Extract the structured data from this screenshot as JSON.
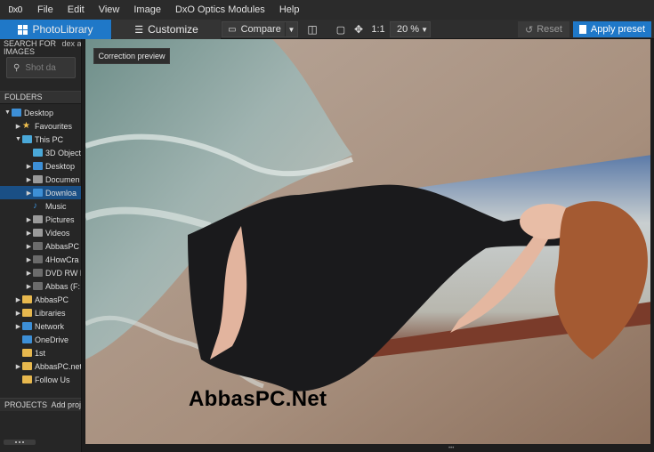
{
  "app": {
    "logo": "DxO"
  },
  "menu": [
    "File",
    "Edit",
    "View",
    "Image",
    "DxO Optics Modules",
    "Help"
  ],
  "toolbar": {
    "tab_photolibrary": "PhotoLibrary",
    "tab_customize": "Customize",
    "compare_label": "Compare",
    "one_to_one": "1:1",
    "zoom_value": "20 %",
    "reset_label": "Reset",
    "apply_preset_label": "Apply preset"
  },
  "sidebar": {
    "search_header": "SEARCH FOR IMAGES",
    "search_header_line1": "SEARCH FOR",
    "search_header_line2": "IMAGES",
    "search_index_hint": "dex a fo",
    "search_placeholder": "Shot da",
    "folders_title": "FOLDERS",
    "projects_title": "PROJECTS",
    "projects_add": "Add proje",
    "tree": [
      {
        "label": "Desktop",
        "expanded": true,
        "indent": 0,
        "icon": "desktop-icon",
        "color": "#3d8fd6"
      },
      {
        "label": "Favourites",
        "expanded": false,
        "indent": 1,
        "icon": "star-icon",
        "color": "#f2c14e"
      },
      {
        "label": "This PC",
        "expanded": true,
        "indent": 1,
        "icon": "computer-icon",
        "color": "#4aa8d8"
      },
      {
        "label": "3D Object",
        "expanded": null,
        "indent": 2,
        "icon": "folder-3d-icon",
        "color": "#4aa8d8"
      },
      {
        "label": "Desktop",
        "expanded": false,
        "indent": 2,
        "icon": "desktop-folder-icon",
        "color": "#3d8fd6"
      },
      {
        "label": "Documen",
        "expanded": false,
        "indent": 2,
        "icon": "documents-icon",
        "color": "#9a9a9a"
      },
      {
        "label": "Downloa",
        "expanded": false,
        "indent": 2,
        "icon": "downloads-icon",
        "color": "#3d8fd6",
        "active": true
      },
      {
        "label": "Music",
        "expanded": null,
        "indent": 2,
        "icon": "music-icon",
        "color": "#3d8fd6"
      },
      {
        "label": "Pictures",
        "expanded": false,
        "indent": 2,
        "icon": "pictures-icon",
        "color": "#9a9a9a"
      },
      {
        "label": "Videos",
        "expanded": false,
        "indent": 2,
        "icon": "videos-icon",
        "color": "#9a9a9a"
      },
      {
        "label": "AbbasPC",
        "expanded": false,
        "indent": 2,
        "icon": "drive-icon",
        "color": "#6b6b6b"
      },
      {
        "label": "4HowCra",
        "expanded": false,
        "indent": 2,
        "icon": "drive-icon",
        "color": "#6b6b6b"
      },
      {
        "label": "DVD RW D",
        "expanded": false,
        "indent": 2,
        "icon": "dvd-drive-icon",
        "color": "#6b6b6b"
      },
      {
        "label": "Abbas (F:",
        "expanded": false,
        "indent": 2,
        "icon": "drive-icon",
        "color": "#6b6b6b"
      },
      {
        "label": "AbbasPC",
        "expanded": false,
        "indent": 1,
        "icon": "folder-icon",
        "color": "#e7b84e"
      },
      {
        "label": "Libraries",
        "expanded": false,
        "indent": 1,
        "icon": "libraries-icon",
        "color": "#e7b84e"
      },
      {
        "label": "Network",
        "expanded": false,
        "indent": 1,
        "icon": "network-icon",
        "color": "#3d8fd6"
      },
      {
        "label": "OneDrive",
        "expanded": null,
        "indent": 1,
        "icon": "onedrive-icon",
        "color": "#3d8fd6"
      },
      {
        "label": "1st",
        "expanded": null,
        "indent": 1,
        "icon": "folder-icon",
        "color": "#e7b84e"
      },
      {
        "label": "AbbasPC.net",
        "expanded": false,
        "indent": 1,
        "icon": "folder-icon",
        "color": "#e7b84e"
      },
      {
        "label": "Follow Us",
        "expanded": null,
        "indent": 1,
        "icon": "folder-icon",
        "color": "#e7b84e"
      }
    ]
  },
  "viewer": {
    "badge": "Correction preview",
    "watermark": "AbbasPC.Net"
  },
  "colors": {
    "accent": "#1f78c8",
    "selection": "#1a4f85",
    "panel": "#262626",
    "menubar": "#2b2b2b"
  }
}
